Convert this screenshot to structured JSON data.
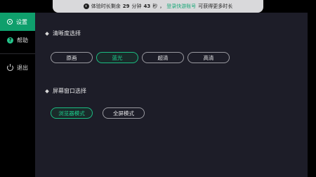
{
  "banner": {
    "prefix": "体验时长剩余",
    "minutes": "29",
    "min_unit": "分钟",
    "seconds": "43",
    "sec_unit": "秒",
    "separator": "，",
    "link": "登录快游账号",
    "suffix": "可获得更多时长"
  },
  "sidebar": {
    "items": [
      {
        "label": "设置",
        "icon": "gear-icon",
        "active": true
      },
      {
        "label": "帮助",
        "icon": "help-icon",
        "active": false
      },
      {
        "label": "退出",
        "icon": "power-icon",
        "active": false
      }
    ]
  },
  "clarity": {
    "title": "清晰度选择",
    "options": [
      "原画",
      "蓝光",
      "超清",
      "高清"
    ],
    "selected": "蓝光"
  },
  "window_mode": {
    "title": "屏幕窗口选择",
    "options": [
      "浏览器模式",
      "全屏模式"
    ],
    "selected": "浏览器模式"
  },
  "colors": {
    "accent": "#0f9f6c",
    "selected_text": "#1bd08e",
    "panel_bg": "#1d1d28"
  }
}
